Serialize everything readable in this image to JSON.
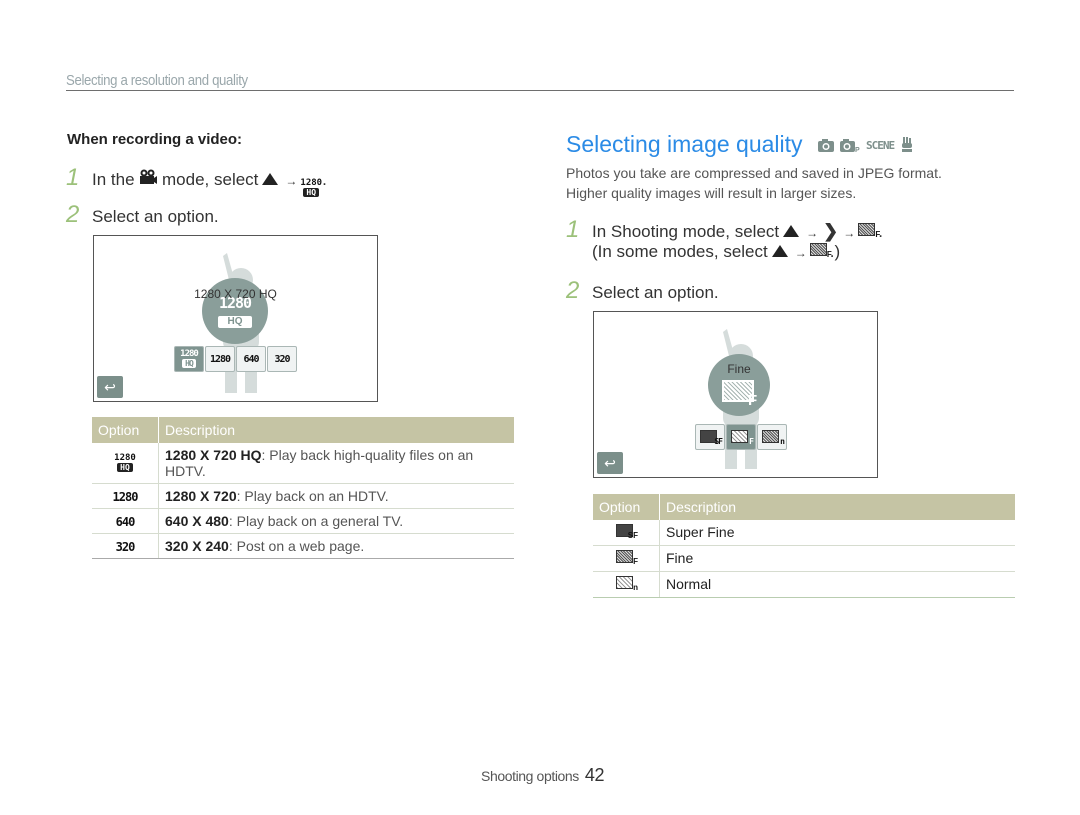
{
  "header": {
    "section_title": "Selecting a resolution and quality"
  },
  "left": {
    "subhead": "When recording a video:",
    "steps": [
      {
        "num": "1",
        "text_a": "In the",
        "icon": "video-camera-icon",
        "text_b": "mode, select",
        "sel_icon_a": "up-triangle-icon",
        "arrow": "→",
        "sel_icon_b": "1280-hq-icon",
        "end": "."
      },
      {
        "num": "2",
        "text": "Select an option."
      }
    ],
    "screen": {
      "dial_label": "1280 X 720 HQ",
      "dial_top": "1280",
      "dial_bot": "HQ",
      "options": [
        "1280 HQ",
        "1280",
        "640",
        "320"
      ],
      "selected_index": 0,
      "back_icon": "↩"
    },
    "table": {
      "headers": [
        "Option",
        "Description"
      ],
      "rows": [
        {
          "icon_top": "1280",
          "icon_bot": "HQ",
          "bold": "1280 X 720 HQ",
          "desc": ": Play back high-quality files on an HDTV."
        },
        {
          "icon": "1280",
          "bold": "1280 X 720",
          "desc": ": Play back on an HDTV."
        },
        {
          "icon": "640",
          "bold": "640 X 480",
          "desc": ": Play back on a general TV."
        },
        {
          "icon": "320",
          "bold": "320 X 240",
          "desc": ": Post on a web page."
        }
      ]
    }
  },
  "right": {
    "title": "Selecting image quality",
    "mode_icons": [
      "camera-icon",
      "camera-p-icon",
      "SCENE",
      "dual-is-icon"
    ],
    "scene_label": "SCENE",
    "paragraph_1": "Photos you take are compressed and saved in JPEG format.",
    "paragraph_2": "Higher quality images will result in larger sizes.",
    "steps": [
      {
        "num": "1",
        "text": "In Shooting mode, select",
        "arrow": "→",
        "end": "."
      },
      {
        "text": "(In some modes, select",
        "arrow": "→",
        "end": ".)"
      },
      {
        "num": "2",
        "text": "Select an option."
      }
    ],
    "screen": {
      "dial_label": "Fine",
      "options": [
        "SF",
        "F",
        "n"
      ],
      "selected_index": 1,
      "back_icon": "↩"
    },
    "table": {
      "headers": [
        "Option",
        "Description"
      ],
      "rows": [
        {
          "icon_label": "SF",
          "desc": "Super Fine"
        },
        {
          "icon_label": "F",
          "desc": "Fine"
        },
        {
          "icon_label": "n",
          "desc": "Normal"
        }
      ]
    }
  },
  "footer": {
    "label": "Shooting options",
    "page": "42"
  }
}
